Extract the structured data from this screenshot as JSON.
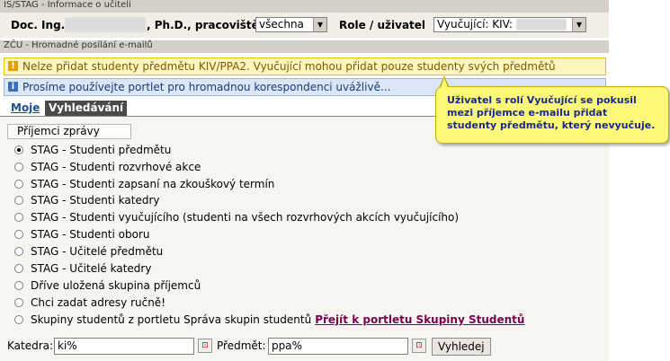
{
  "portlet1": {
    "title": "IS/STAG - Informace o učiteli"
  },
  "teacher": {
    "name_prefix": "Doc. Ing.",
    "name_suffix": ", Ph.D., pracoviště",
    "workplace_select": "všechna",
    "role_label": "Role / uživatel",
    "role_select": "Vyučující: KIV:"
  },
  "portlet2": {
    "title": "ZČU - Hromadné posílání e-mailů"
  },
  "messages": {
    "warning": "Nelze přidat studenty předmětu KIV/PPA2. Vyučující mohou přidat pouze studenty svých předmětů",
    "info": "Prosíme používejte portlet pro hromadnou korespondenci uvážlivě..."
  },
  "tabs": {
    "moje": "Moje",
    "vyhledavani": "Vyhledávání"
  },
  "recipients": {
    "legend": "Příjemci zprávy",
    "options": [
      "STAG - Studenti předmětu",
      "STAG - Studenti rozvrhové akce",
      "STAG - Studenti zapsaní na zkouškový termín",
      "STAG - Studenti katedry",
      "STAG - Studenti vyučujícího (studenti na všech rozvrhových akcích vyučujícího)",
      "STAG - Studenti oboru",
      "STAG - Učitelé předmětu",
      "STAG - Učitelé katedry",
      "Dříve uložená skupina příjemců",
      "Chci zadat adresy ručně!",
      "Skupiny studentů z portletu Správa skupin studentů"
    ],
    "groups_link": "Přejít k portletu Skupiny Studentů"
  },
  "search": {
    "katedra_label": "Katedra:",
    "katedra_value": "ki%",
    "predmet_label": "Předmět:",
    "predmet_value": "ppa%",
    "button": "Vyhledej"
  },
  "callout": {
    "text": "Uživatel s rolí Vyučující se pokusil mezi příjemce e-mailu přidat studenty předmětu, který nevyučuje."
  }
}
